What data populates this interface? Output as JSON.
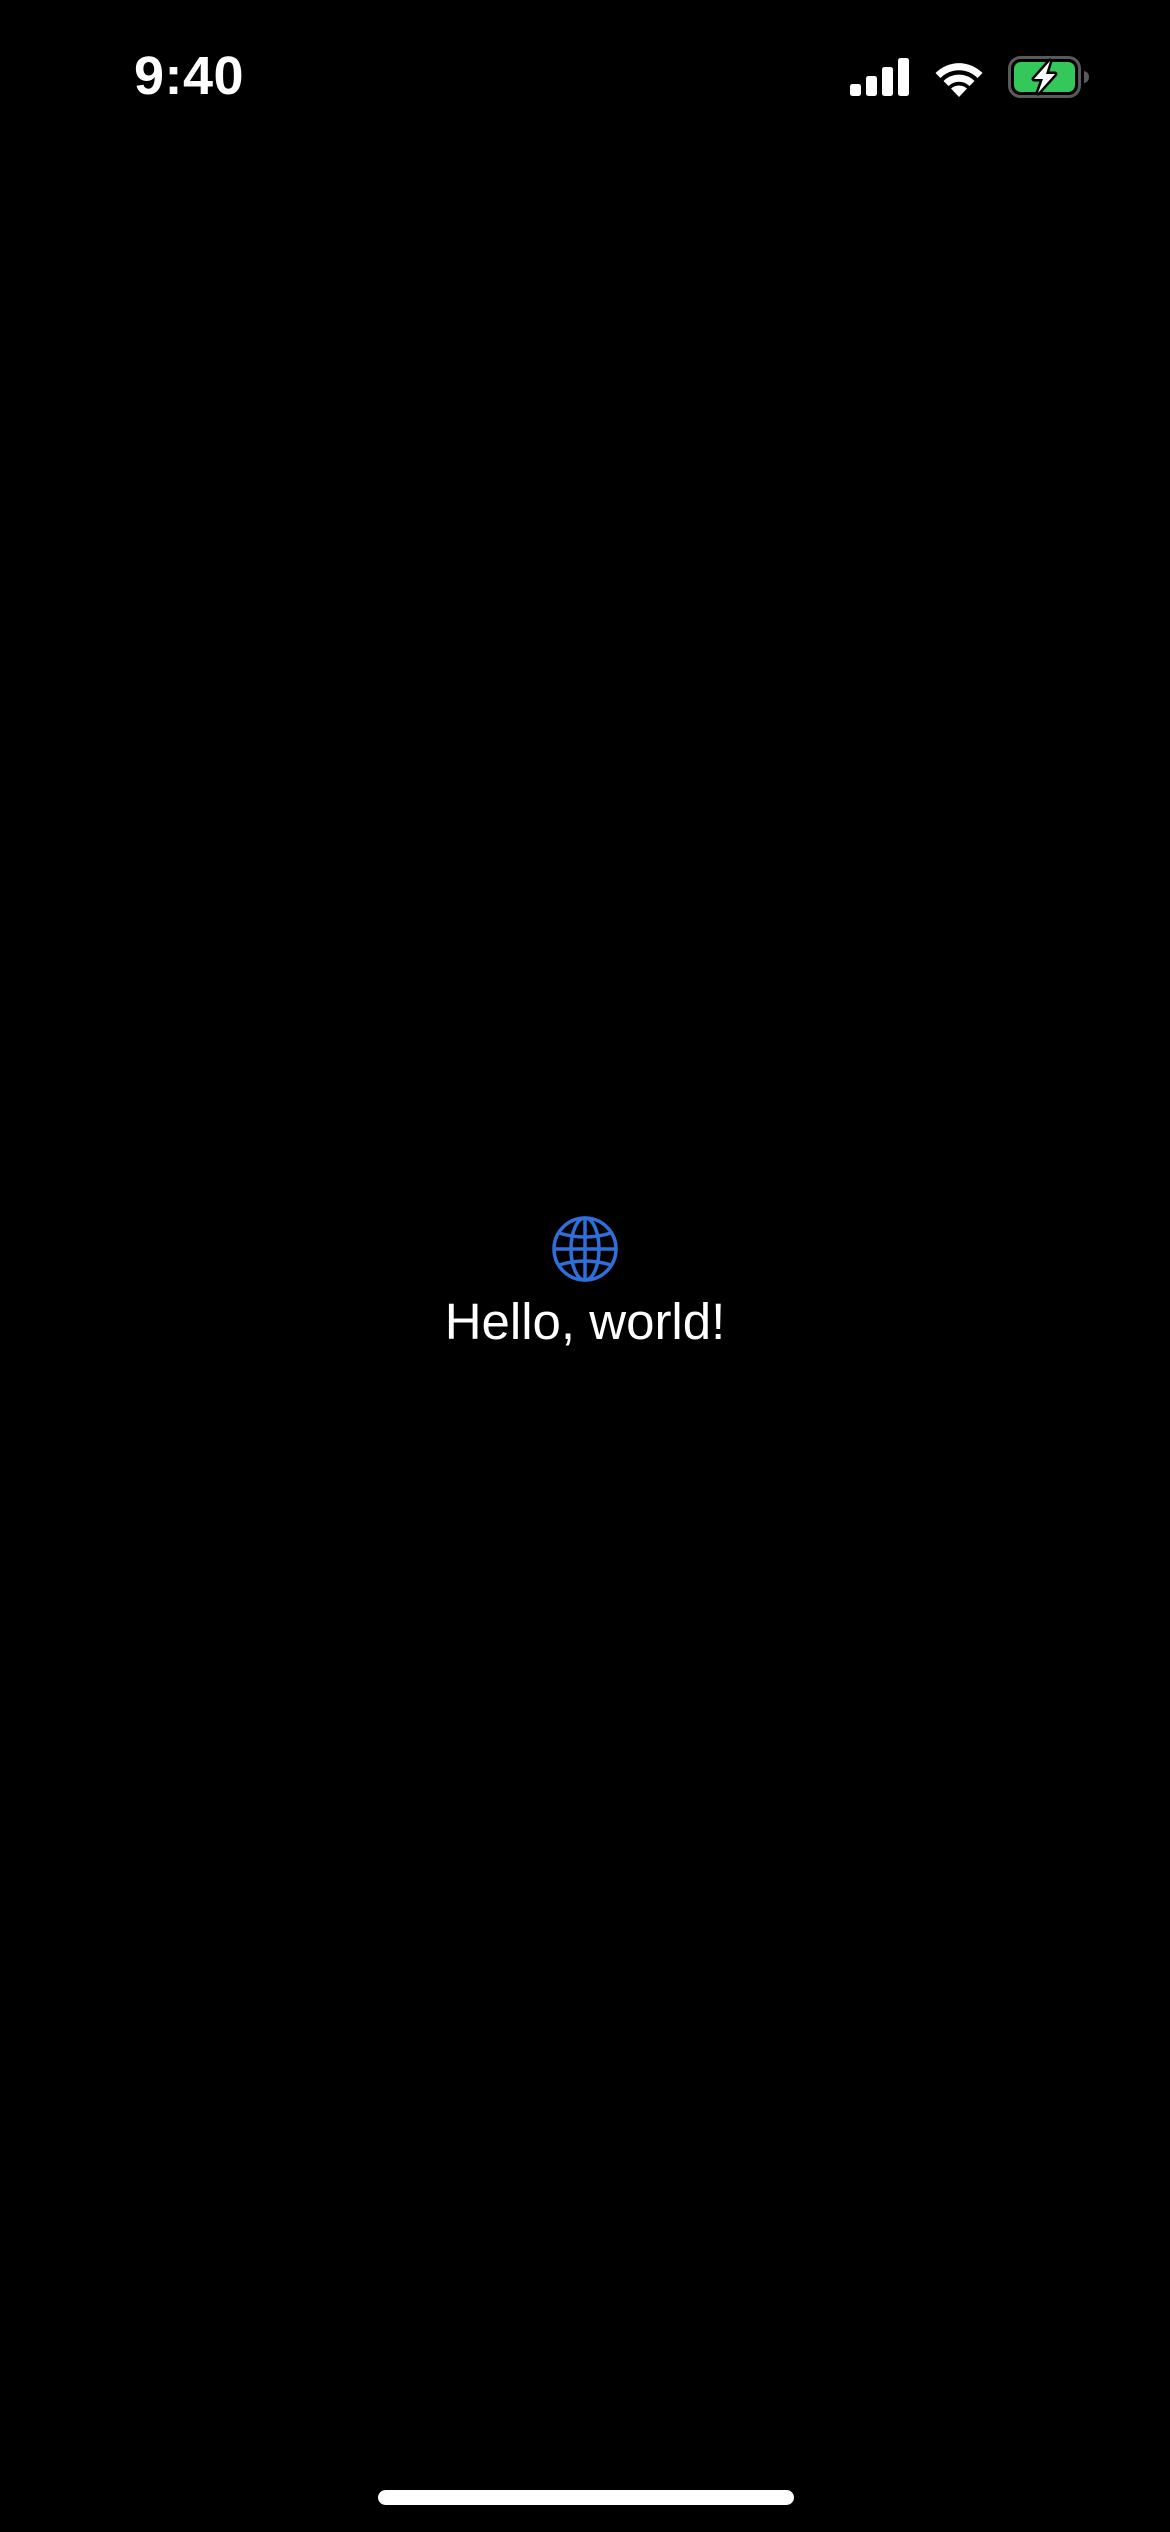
{
  "status_bar": {
    "time": "9:40",
    "signal_icon": "cellular-signal-icon",
    "wifi_icon": "wifi-icon",
    "battery_icon": "battery-charging-icon",
    "battery_color": "#34C759"
  },
  "content": {
    "icon": "globe-icon",
    "icon_color": "#2F6FDB",
    "greeting": "Hello, world!"
  },
  "home_indicator": {
    "color": "#FFFFFF"
  },
  "colors": {
    "background": "#000000",
    "text": "#FFFFFF"
  }
}
